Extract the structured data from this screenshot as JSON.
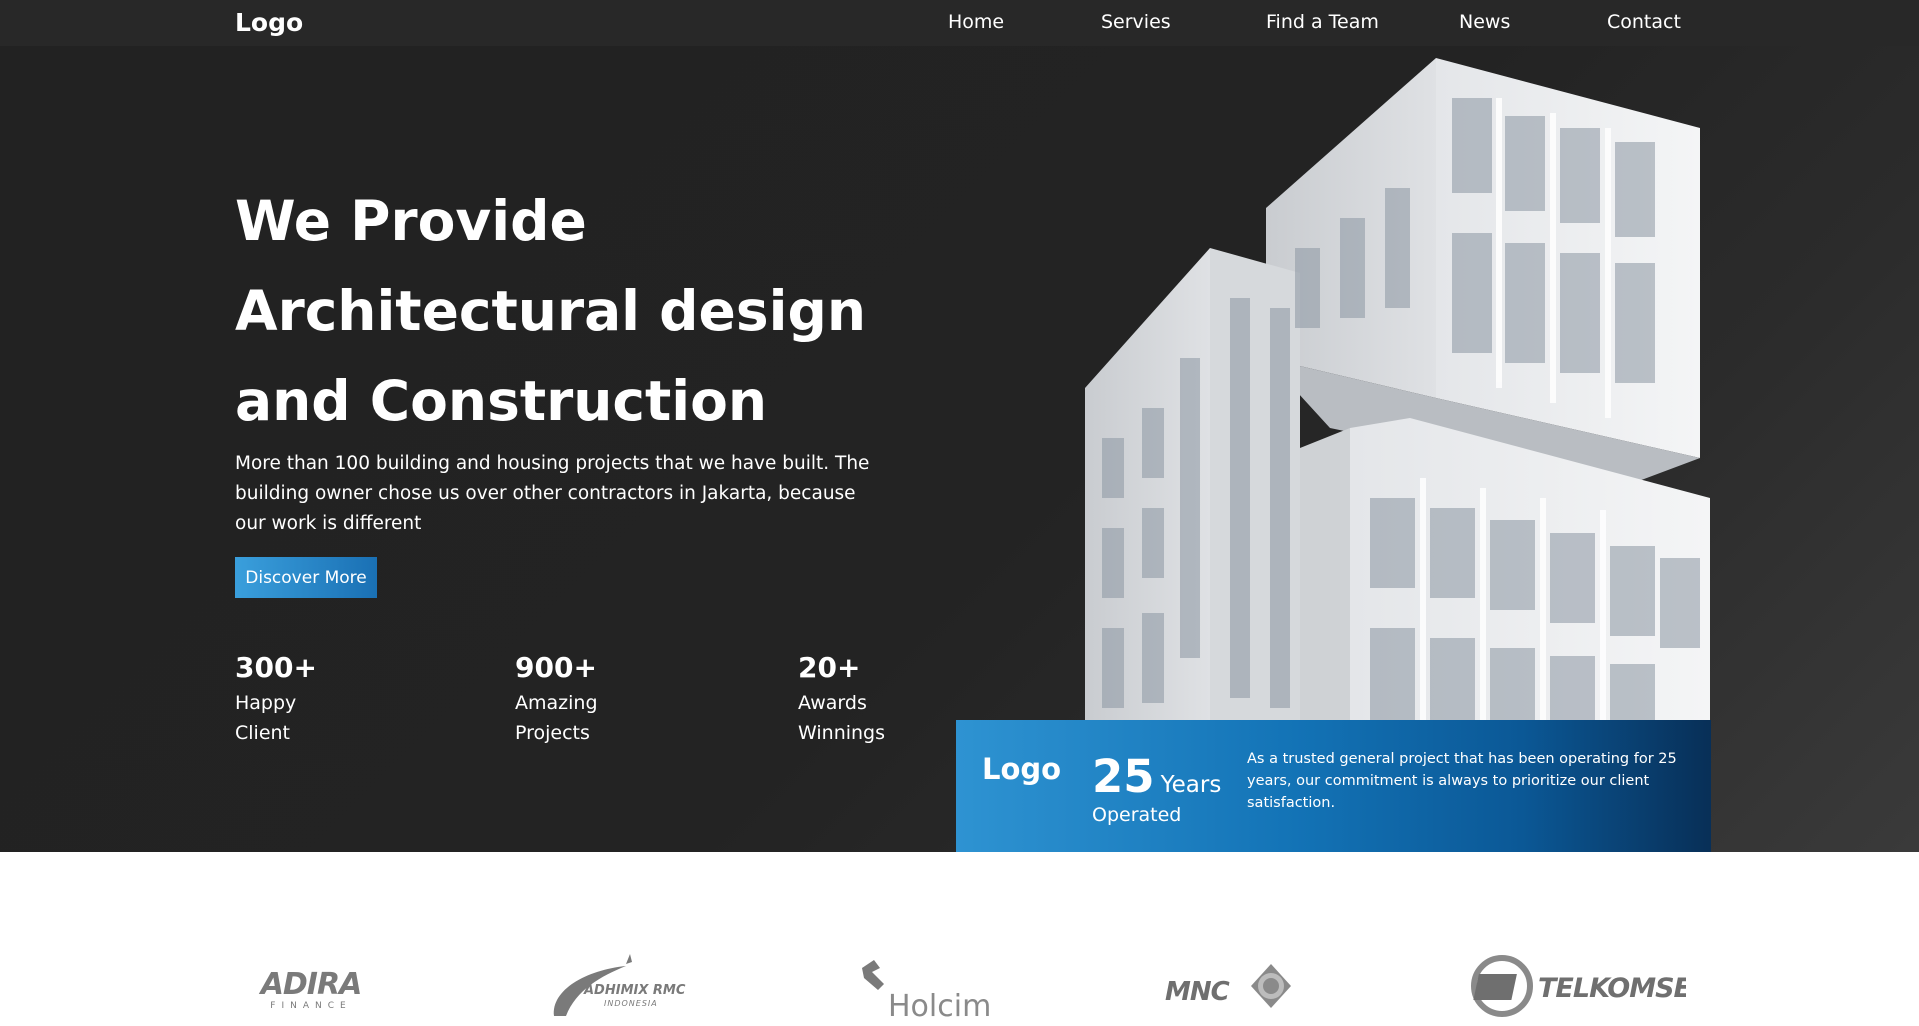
{
  "nav": {
    "logo": "Logo",
    "links": [
      "Home",
      "Servies",
      "Find a Team",
      "News",
      "Contact"
    ]
  },
  "hero": {
    "title": "We Provide Architectural design and Construction",
    "description": "More than 100 building and housing projects that we have built. The building owner chose us over other contractors in Jakarta, because our work is different",
    "button_label": "Discover More",
    "stats": [
      {
        "number": "300+",
        "label_line1": "Happy",
        "label_line2": "Client"
      },
      {
        "number": "900+",
        "label_line1": "Amazing",
        "label_line2": "Projects"
      },
      {
        "number": "20+",
        "label_line1": "Awards",
        "label_line2": "Winnings"
      }
    ]
  },
  "card": {
    "logo": "Logo",
    "years_number": "25",
    "years_unit": "Years",
    "operated": "Operated",
    "text": "As a trusted general project that has been operating for 25 years, our commitment is always to prioritize our client satisfaction."
  },
  "clients": {
    "adira": "ADIRA",
    "adira_sub": "FINANCE",
    "adhimix": "ADHIMIX RMC",
    "adhimix_sub": "INDONESIA",
    "holcim": "Holcim",
    "mnc": "MNC",
    "telkomsel": "TELKOMSEL"
  },
  "colors": {
    "nav_bg": "#282828",
    "hero_bg": "#232323",
    "accent": "#1a70b4",
    "card_start": "#2e93d2",
    "card_end": "#082f57",
    "logo_gray": "#7a7a7a"
  }
}
